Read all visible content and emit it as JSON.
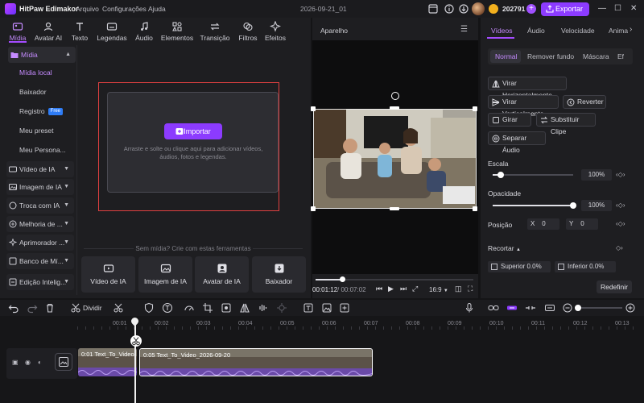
{
  "app": {
    "title": "HitPaw Edimakor",
    "menu": [
      "Arquivo",
      "Configurações",
      "Ajuda"
    ],
    "doc_title": "2026-09-21_01",
    "credits": "202791",
    "export_label": "Exportar"
  },
  "media_tabs": [
    {
      "label": "Mídia",
      "icon": "media-icon"
    },
    {
      "label": "Avatar AI",
      "icon": "avatar-icon"
    },
    {
      "label": "Texto",
      "icon": "text-icon"
    },
    {
      "label": "Legendas",
      "icon": "subtitles-icon"
    },
    {
      "label": "Áudio",
      "icon": "audio-icon"
    },
    {
      "label": "Elementos",
      "icon": "elements-icon"
    },
    {
      "label": "Transição",
      "icon": "transition-icon"
    },
    {
      "label": "Filtros",
      "icon": "filters-icon"
    },
    {
      "label": "Efeitos",
      "icon": "effects-icon"
    }
  ],
  "sidebar": {
    "head": "Mídia",
    "subs": [
      "Mídia local",
      "Baixador",
      "Registro",
      "Meu preset",
      "Meu Persona..."
    ],
    "free_badge": "Free",
    "groups": [
      "Vídeo de IA",
      "Imagem de IA",
      "Troca com IA",
      "Melhoria de ...",
      "Aprimorador ...",
      "Banco de Mí...",
      "Edição Intelig..."
    ]
  },
  "import": {
    "button": "Importar",
    "hint": "Arraste e solte ou clique aqui para adicionar vídeos, áudios, fotos e legendas."
  },
  "tools": {
    "heading": "Sem mídia? Crie com estas ferramentas",
    "items": [
      "Vídeo de IA",
      "Imagem de IA",
      "Avatar de IA",
      "Baixador"
    ]
  },
  "preview": {
    "title": "Aparelho",
    "time_current": "00:01:12",
    "time_total": "/ 00:07:02",
    "ratio": "16:9",
    "progress": 0.17
  },
  "right": {
    "tabs": [
      "Vídeos",
      "Áudio",
      "Velocidade",
      "Animaç"
    ],
    "subtabs": [
      "Normal",
      "Remover fundo",
      "Máscara",
      "Ef"
    ],
    "buttons": {
      "flip_h": "Virar Horizontalmente",
      "flip_v": "Virar Verticalmente",
      "reverse": "Reverter",
      "rotate": "Girar",
      "replace": "Substituir Clipe",
      "split_audio": "Separar Áudio"
    },
    "scale_label": "Escala",
    "scale_value": "100%",
    "scale_level": 0.1,
    "opacity_label": "Opacidade",
    "opacity_value": "100%",
    "opacity_level": 1.0,
    "position_label": "Posição",
    "pos_x_label": "X",
    "pos_x": "0",
    "pos_y_label": "Y",
    "pos_y": "0",
    "crop_label": "Recortar",
    "top_label": "Superior",
    "top_value": "0.0%",
    "bottom_label": "Inferior",
    "bottom_value": "0.0%",
    "reset": "Redefinir"
  },
  "timeline": {
    "split_label": "Dividir",
    "ruler": [
      "00:01",
      "00:02",
      "00:03",
      "00:04",
      "00:05",
      "00:06",
      "00:07",
      "00:08",
      "00:09",
      "00:10",
      "00:11",
      "00:12",
      "00:13"
    ],
    "clips": [
      "0:01 Text_To_Video",
      "0:05 Text_To_Video_2026-09-20"
    ]
  },
  "colors": {
    "accent": "#8c3bff",
    "accent_text": "#c58bff",
    "highlight_border": "#e04040"
  }
}
